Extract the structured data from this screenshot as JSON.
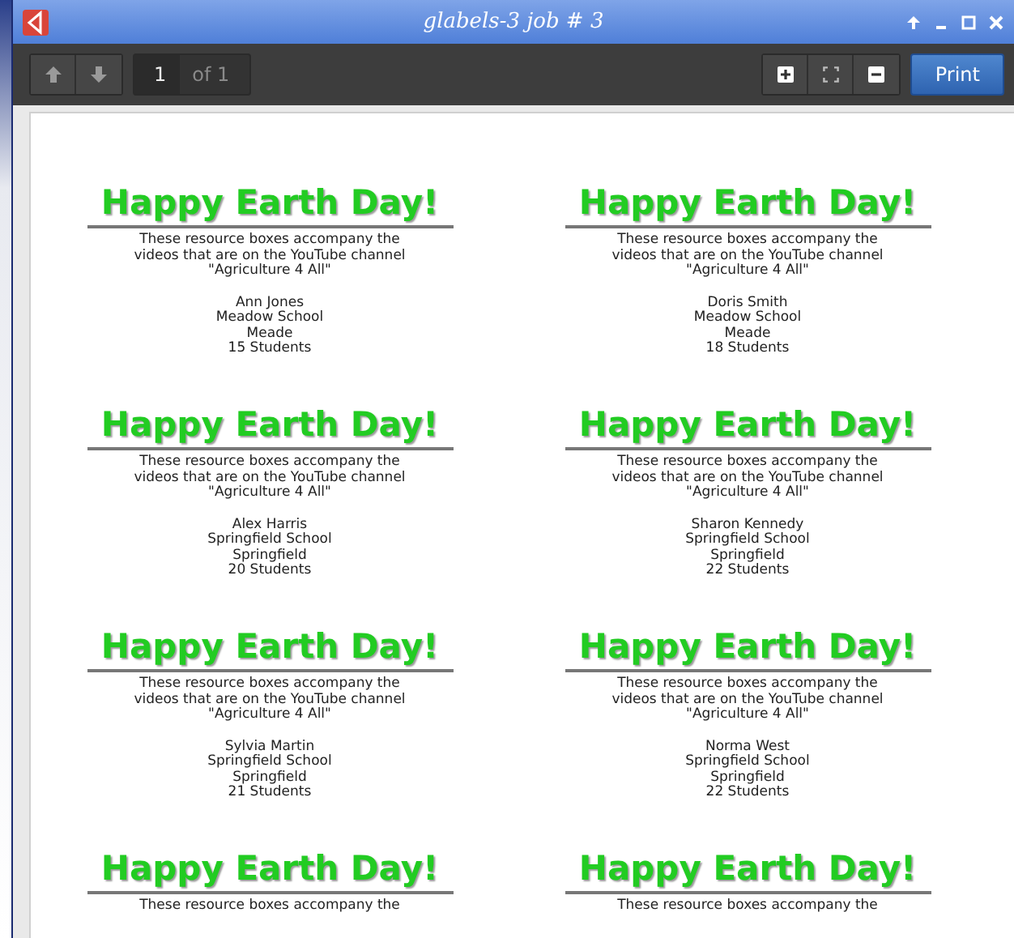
{
  "window": {
    "title": "glabels-3 job # 3"
  },
  "toolbar": {
    "page_number": "1",
    "page_total": "of 1",
    "print_button": "Print"
  },
  "labels": [
    {
      "heading": "Happy Earth Day!",
      "description": [
        "These resource boxes accompany the",
        "videos that are on the YouTube channel",
        "\"Agriculture 4 All\""
      ],
      "address": [
        "Ann Jones",
        "Meadow School",
        "Meade",
        "15 Students"
      ]
    },
    {
      "heading": "Happy Earth Day!",
      "description": [
        "These resource boxes accompany the",
        "videos that are on the YouTube channel",
        "\"Agriculture 4 All\""
      ],
      "address": [
        "Doris Smith",
        "Meadow School",
        "Meade",
        "18 Students"
      ]
    },
    {
      "heading": "Happy Earth Day!",
      "description": [
        "These resource boxes accompany the",
        "videos that are on the YouTube channel",
        "\"Agriculture 4 All\""
      ],
      "address": [
        "Alex Harris",
        "Springfield School",
        "Springfield",
        "20 Students"
      ]
    },
    {
      "heading": "Happy Earth Day!",
      "description": [
        "These resource boxes accompany the",
        "videos that are on the YouTube channel",
        "\"Agriculture 4 All\""
      ],
      "address": [
        "Sharon Kennedy",
        "Springfield School",
        "Springfield",
        "22 Students"
      ]
    },
    {
      "heading": "Happy Earth Day!",
      "description": [
        "These resource boxes accompany the",
        "videos that are on the YouTube channel",
        "\"Agriculture 4 All\""
      ],
      "address": [
        "Sylvia Martin",
        "Springfield School",
        "Springfield",
        "21 Students"
      ]
    },
    {
      "heading": "Happy Earth Day!",
      "description": [
        "These resource boxes accompany the",
        "videos that are on the YouTube channel",
        "\"Agriculture 4 All\""
      ],
      "address": [
        "Norma West",
        "Springfield School",
        "Springfield",
        "22 Students"
      ]
    },
    {
      "heading": "Happy Earth Day!",
      "description": [
        "These resource boxes accompany the"
      ]
    },
    {
      "heading": "Happy Earth Day!",
      "description": [
        "These resource boxes accompany the"
      ]
    }
  ]
}
